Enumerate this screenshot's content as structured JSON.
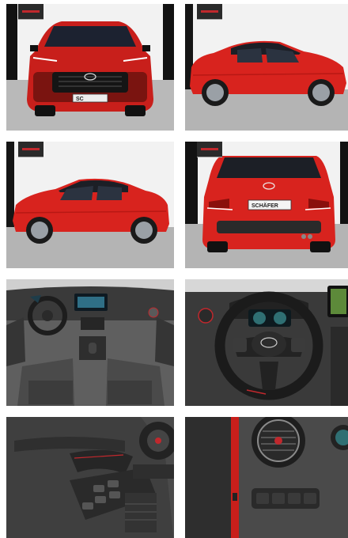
{
  "gallery": {
    "images": [
      {
        "name": "front-view",
        "plate": "SC"
      },
      {
        "name": "side-view-right"
      },
      {
        "name": "side-view-left"
      },
      {
        "name": "rear-view",
        "plate": "SCHÄFER"
      },
      {
        "name": "interior-dashboard"
      },
      {
        "name": "steering-wheel"
      },
      {
        "name": "door-panel"
      },
      {
        "name": "air-vent-controls"
      }
    ]
  },
  "colors": {
    "car_red": "#d8231e",
    "car_roof": "#1c1f26",
    "showroom_floor": "#b9b9b9",
    "showroom_wall": "#f2f2f2"
  }
}
